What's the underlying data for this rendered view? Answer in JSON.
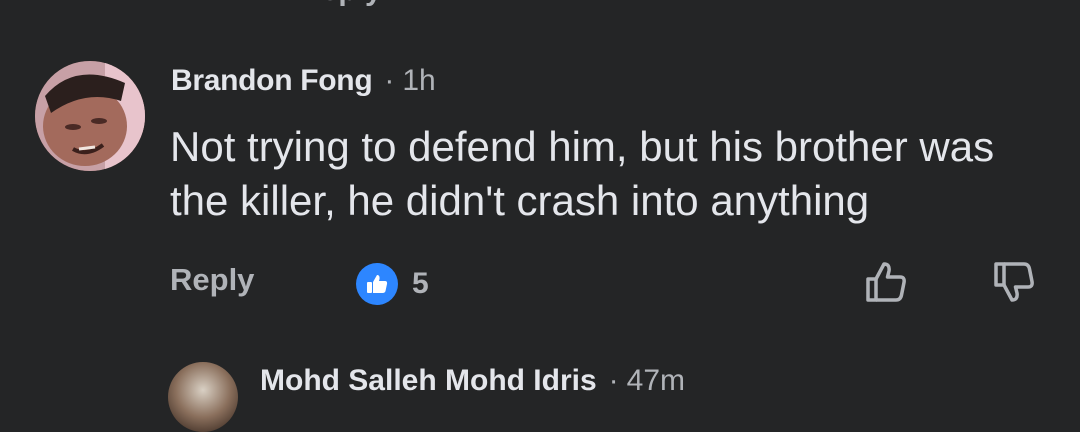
{
  "top_clip_text": "Reply",
  "comment": {
    "author": "Brandon Fong",
    "separator": "·",
    "time": "1h",
    "text": "Not trying to defend him, but his brother was the killer, he didn't crash into anything",
    "reply_label": "Reply",
    "like_count": "5",
    "colors": {
      "background": "#242526",
      "primary_text": "#e4e6eb",
      "secondary_text": "#b0b3b8",
      "like_accent": "#2d86ff"
    },
    "icons": {
      "reaction": "like-thumb-icon",
      "like_button": "thumbs-up-outline-icon",
      "dislike_button": "thumbs-down-outline-icon"
    }
  },
  "next_comment": {
    "author": "Mohd Salleh Mohd Idris",
    "separator": "·",
    "time": "47m"
  }
}
